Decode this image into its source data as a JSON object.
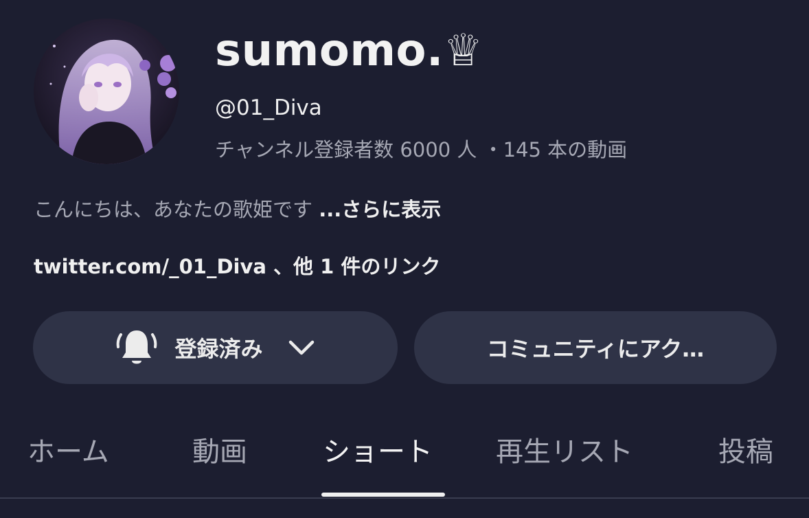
{
  "channel": {
    "name": "sumomo.♕",
    "handle": "@01_Diva",
    "stats": "チャンネル登録者数 6000 人 ・145 本の動画",
    "description": "こんにちは、あなたの歌姫です ",
    "description_more": "...さらに表示",
    "links": "twitter.com/_01_Diva 、他 1 件のリンク"
  },
  "buttons": {
    "subscribe_label": "登録済み",
    "community_label": "コミュニティにアク…"
  },
  "tabs": [
    {
      "label": "ホーム"
    },
    {
      "label": "動画"
    },
    {
      "label": "ショート",
      "active": true
    },
    {
      "label": "再生リスト"
    },
    {
      "label": "投稿"
    }
  ],
  "icons": {
    "bell": "bell-icon",
    "chevron": "chevron-down-icon"
  },
  "colors": {
    "background": "#1c1e30",
    "button_bg": "#2f3347",
    "muted_text": "#a6a8b4",
    "primary_text": "#f0f0f0"
  }
}
